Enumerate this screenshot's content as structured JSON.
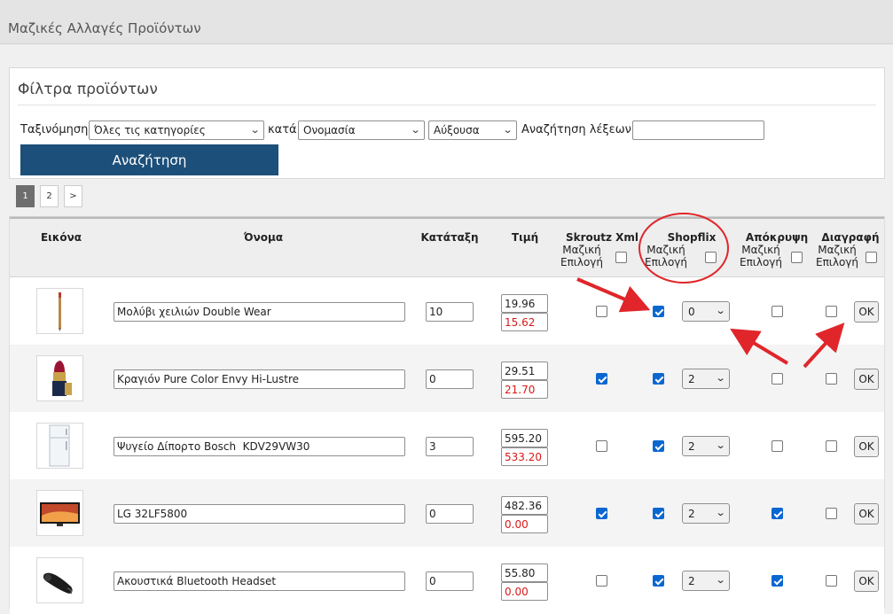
{
  "header": {
    "title": "Μαζικές Αλλαγές Προϊόντων"
  },
  "filters": {
    "title": "Φίλτρα προϊόντων",
    "sort_label": "Ταξινόμηση",
    "category_select": "Όλες τις κατηγορίες",
    "by_label": "κατά",
    "field_select": "Ονομασία",
    "order_select": "Αύξουσα",
    "keyword_label": "Αναζήτηση λέξεων:",
    "keyword_value": "",
    "search_button": "Αναζήτηση"
  },
  "pagination": {
    "pages": [
      "1",
      "2"
    ],
    "current": "1",
    "next": ">"
  },
  "table": {
    "columns": {
      "image": "Εικόνα",
      "name": "Όνομα",
      "rank": "Κατάταξη",
      "price": "Τιμή",
      "skroutz": "Skroutz Xml",
      "shopflix": "Shopflix",
      "hide": "Απόκρυψη",
      "delete": "Διαγραφή"
    },
    "bulk_label_1": "Μαζική",
    "bulk_label_2": "Επιλογή",
    "ok_label": "OK",
    "rows": [
      {
        "image": "lip-pencil-image",
        "name": "Μολύβι χειλιών Double Wear",
        "rank": "10",
        "price": "19.96",
        "sale_price": "15.62",
        "skroutz": false,
        "shopflix": true,
        "shopflix_value": "0",
        "hide": false,
        "delete": false
      },
      {
        "image": "lipstick-image",
        "name": "Κραγιόν Pure Color Envy Hi-Lustre",
        "rank": "0",
        "price": "29.51",
        "sale_price": "21.70",
        "skroutz": true,
        "shopflix": true,
        "shopflix_value": "2",
        "hide": false,
        "delete": false
      },
      {
        "image": "fridge-image",
        "name": "Ψυγείο Δίπορτο Bosch  KDV29VW30",
        "rank": "3",
        "price": "595.20",
        "sale_price": "533.20",
        "skroutz": false,
        "shopflix": true,
        "shopflix_value": "2",
        "hide": false,
        "delete": false
      },
      {
        "image": "tv-image",
        "name": "LG 32LF5800",
        "rank": "0",
        "price": "482.36",
        "sale_price": "0.00",
        "skroutz": true,
        "shopflix": true,
        "shopflix_value": "2",
        "hide": true,
        "delete": false
      },
      {
        "image": "bluetooth-headset-image",
        "name": "Ακουστικά Bluetooth Headset",
        "rank": "0",
        "price": "55.80",
        "sale_price": "0.00",
        "skroutz": false,
        "shopflix": true,
        "shopflix_value": "2",
        "hide": true,
        "delete": false
      }
    ]
  },
  "colors": {
    "accent": "#1c4f79",
    "checkbox": "#0b67d0",
    "sale_price": "#d81818",
    "annotation": "#e0262a"
  }
}
